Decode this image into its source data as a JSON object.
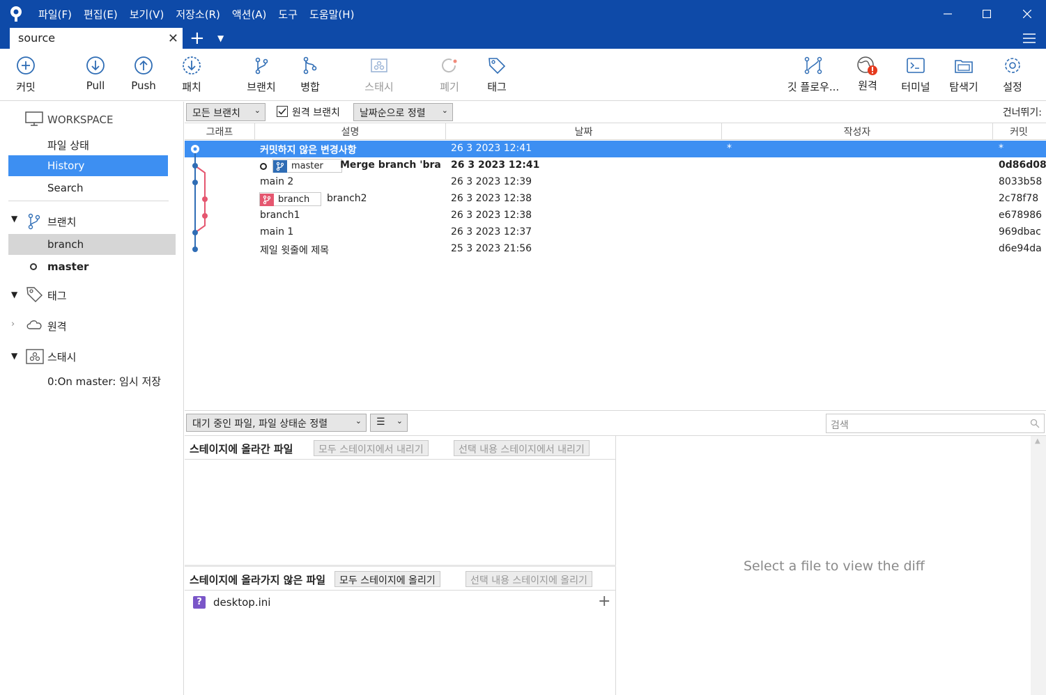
{
  "menu": [
    "파일(F)",
    "편집(E)",
    "보기(V)",
    "저장소(R)",
    "액션(A)",
    "도구",
    "도움말(H)"
  ],
  "tab": {
    "label": "source"
  },
  "toolbar": {
    "commit": "커밋",
    "pull": "Pull",
    "push": "Push",
    "fetch": "패치",
    "branch": "브랜치",
    "merge": "병합",
    "stash": "스태시",
    "discard": "폐기",
    "tag": "태그",
    "gitflow": "깃 플로우...",
    "remote": "원격",
    "terminal": "터미널",
    "explorer": "탐색기",
    "settings": "설정"
  },
  "sidebar": {
    "workspace": "WORKSPACE",
    "file_status": "파일 상태",
    "history": "History",
    "search": "Search",
    "branches_title": "브랜치",
    "branches": [
      "branch",
      "master"
    ],
    "tags_title": "태그",
    "remotes_title": "원격",
    "stash_title": "스태시",
    "stash_items": [
      "0:On master: 임시 저장"
    ]
  },
  "log": {
    "filter_branches": "모든 브랜치",
    "remote_branches_label": "원격 브랜치",
    "remote_branches_checked": true,
    "sort": "날짜순으로 정렬",
    "jump": "건너뛰기:",
    "columns": {
      "graph": "그래프",
      "desc": "설명",
      "date": "날짜",
      "author": "작성자",
      "commit": "커밋"
    },
    "rows": [
      {
        "desc": "커밋하지 않은 변경사항",
        "date": "26 3 2023 12:41",
        "author": "*",
        "hash": "*"
      },
      {
        "desc": "Merge branch 'bran",
        "date": "26 3 2023 12:41",
        "author": "",
        "hash": "0d86d08",
        "badge": "master"
      },
      {
        "desc": "main 2",
        "date": "26 3 2023 12:39",
        "author": "",
        "hash": "8033b58"
      },
      {
        "desc": "branch2",
        "date": "26 3 2023 12:38",
        "author": "",
        "hash": "2c78f78",
        "badge": "branch"
      },
      {
        "desc": "branch1",
        "date": "26 3 2023 12:38",
        "author": "",
        "hash": "e678986"
      },
      {
        "desc": "main 1",
        "date": "26 3 2023 12:37",
        "author": "",
        "hash": "969dbac"
      },
      {
        "desc": "제일 윗줄에 제목",
        "date": "25 3 2023 21:56",
        "author": "",
        "hash": "d6e94da"
      }
    ]
  },
  "bottom": {
    "sort": "대기 중인 파일, 파일 상태순 정렬",
    "view_icon": "☰",
    "search_placeholder": "검색",
    "staged_title": "스테이지에 올라간 파일",
    "unstage_all": "모두 스테이지에서 내리기",
    "unstage_selected": "선택 내용 스테이지에서 내리기",
    "unstaged_title": "스테이지에 올라가지 않은 파일",
    "stage_all": "모두 스테이지에 올리기",
    "stage_selected": "선택 내용 스테이지에 올리기",
    "unstaged_files": [
      "desktop.ini"
    ],
    "diff_message": "Select a file to view the diff"
  },
  "colors": {
    "titlebar": "#0e4aa8",
    "selection": "#3d8ff2",
    "branch_badge": "#e5566f",
    "master_badge": "#2f6db5"
  }
}
